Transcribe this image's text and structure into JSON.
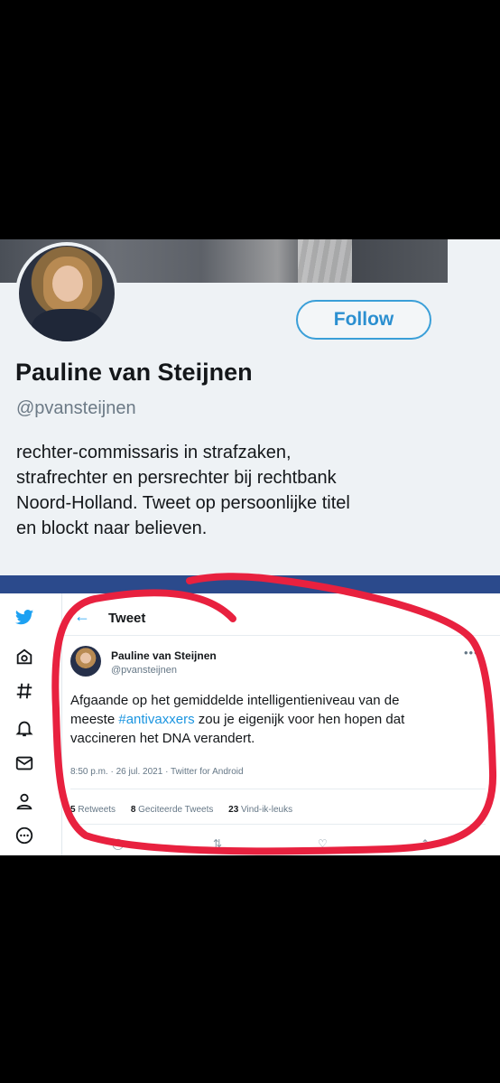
{
  "profile": {
    "name": "Pauline van Steijnen",
    "handle": "@pvansteijnen",
    "follow_label": "Follow",
    "bio_lines": [
      "rechter-commissaris in strafzaken,",
      "strafrechter en persrechter bij rechtbank",
      "Noord-Holland. Tweet op persoonlijke titel",
      "en blockt naar believen."
    ]
  },
  "tweet_view": {
    "header_title": "Tweet",
    "author_name": "Pauline van Steijnen",
    "author_handle": "@pvansteijnen",
    "more_label": "•••",
    "text_line1": "Afgaande op het gemiddelde intelligentieniveau van de",
    "text_line2_pre": "meeste ",
    "hashtag": "#antivaxxers",
    "text_line2_post": " zou je eigenijk voor hen hopen dat",
    "text_line3": "vaccineren het DNA verandert.",
    "meta": "8:50 p.m. · 26 jul. 2021 · Twitter for Android",
    "retweets_count": "5",
    "retweets_label": "Retweets",
    "quotes_count": "8",
    "quotes_label": "Geciteerde Tweets",
    "likes_count": "23",
    "likes_label": "Vind-ik-leuks"
  },
  "colors": {
    "accent": "#1da1f2",
    "annotation_red": "#e8213f",
    "page_background": "#000000",
    "tweet_background": "#eef2f5"
  },
  "icons": [
    "twitter-bird-icon",
    "home-icon",
    "hashtag-icon",
    "bell-icon",
    "mail-icon",
    "profile-icon",
    "more-circle-icon"
  ]
}
